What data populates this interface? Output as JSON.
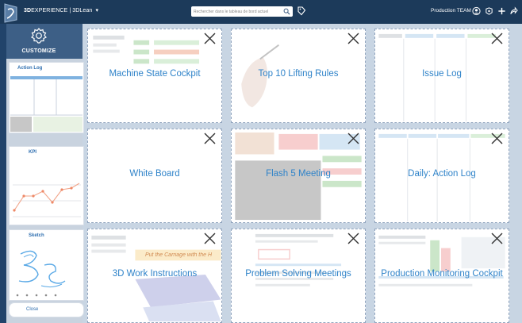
{
  "topbar": {
    "brand_bold": "3D",
    "brand_rest": "EXPERIENCE | 3DLean",
    "brand_caret": "▾",
    "search_placeholder": "Rechercher dans le tableau de bord actuel",
    "user_label": "Production TEAM",
    "icons": [
      "user-icon",
      "share-icon",
      "add-icon",
      "forward-icon"
    ]
  },
  "panel": {
    "title": "CUSTOMIZE",
    "widgets": [
      {
        "label": "Action Log"
      },
      {
        "label": "KPI"
      },
      {
        "label": "Sketch"
      }
    ],
    "close_label": "Close"
  },
  "tiles": [
    {
      "title": "Machine State Cockpit"
    },
    {
      "title": "Top 10 Lifting Rules"
    },
    {
      "title": "Issue Log"
    },
    {
      "title": "White Board"
    },
    {
      "title": "Flash 5 Meeting"
    },
    {
      "title": "Daily: Action Log"
    },
    {
      "title": "3D Work Instructions"
    },
    {
      "title": "Problem Solving Meetings"
    },
    {
      "title": "Production Monitoring Cockpit"
    }
  ],
  "tile_overlay_text": "Put the Carriage with the H",
  "colors": {
    "topbar": "#1c3a5a",
    "accent_blue": "#2f83c9",
    "panel_header": "#3d5f86",
    "canvas": "#c8d5e3"
  }
}
